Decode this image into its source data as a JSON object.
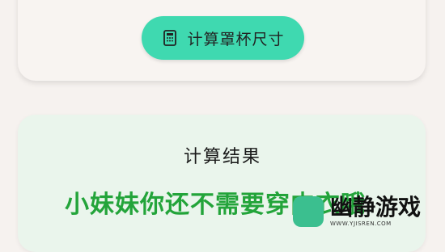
{
  "calculator": {
    "button_label": "计算罩杯尺寸",
    "icon": "calculator-icon"
  },
  "result": {
    "title": "计算结果",
    "message": "小妹妹你还不需要穿内衣哦"
  },
  "watermark": {
    "title": "幽静游戏",
    "url": "WWW.YJISREN.COM"
  },
  "colors": {
    "button_bg": "#3fd9b0",
    "result_text": "#23a43a",
    "result_card_bg": "#eaf5ec",
    "page_bg": "#f6f2ef"
  }
}
